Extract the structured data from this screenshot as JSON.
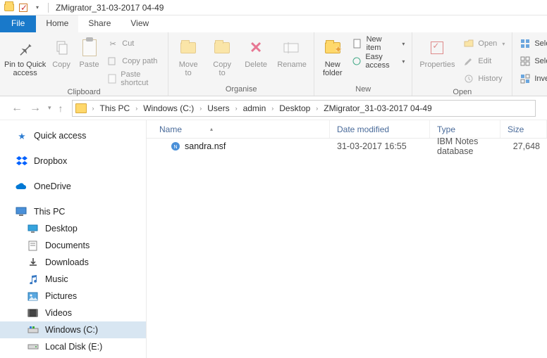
{
  "window": {
    "title": "ZMigrator_31-03-2017 04-49"
  },
  "tabs": {
    "file": "File",
    "home": "Home",
    "share": "Share",
    "view": "View"
  },
  "ribbon": {
    "clipboard": {
      "label": "Clipboard",
      "pin": "Pin to Quick\naccess",
      "copy": "Copy",
      "paste": "Paste",
      "cut": "Cut",
      "copy_path": "Copy path",
      "paste_shortcut": "Paste shortcut"
    },
    "organise": {
      "label": "Organise",
      "move_to": "Move\nto",
      "copy_to": "Copy\nto",
      "delete": "Delete",
      "rename": "Rename"
    },
    "new": {
      "label": "New",
      "new_folder": "New\nfolder",
      "new_item": "New item",
      "easy_access": "Easy access"
    },
    "open": {
      "label": "Open",
      "properties": "Properties",
      "open": "Open",
      "edit": "Edit",
      "history": "History"
    },
    "select": {
      "sel1": "Sele",
      "sel2": "Sele",
      "sel3": "Inve"
    }
  },
  "breadcrumb": {
    "items": [
      "This PC",
      "Windows (C:)",
      "Users",
      "admin",
      "Desktop",
      "ZMigrator_31-03-2017 04-49"
    ]
  },
  "sidebar": {
    "quick_access": "Quick access",
    "dropbox": "Dropbox",
    "onedrive": "OneDrive",
    "this_pc": "This PC",
    "desktop": "Desktop",
    "documents": "Documents",
    "downloads": "Downloads",
    "music": "Music",
    "pictures": "Pictures",
    "videos": "Videos",
    "windows_c": "Windows (C:)",
    "local_e": "Local Disk (E:)"
  },
  "columns": {
    "name": "Name",
    "date": "Date modified",
    "type": "Type",
    "size": "Size"
  },
  "files": [
    {
      "name": "sandra.nsf",
      "date": "31-03-2017 16:55",
      "type": "IBM Notes database",
      "size": "27,648"
    }
  ]
}
